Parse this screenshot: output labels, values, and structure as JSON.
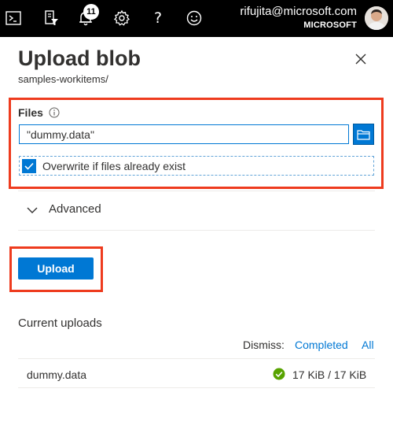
{
  "topbar": {
    "icons": [
      "cloud-shell-icon",
      "directory-filter-icon",
      "notifications-icon",
      "settings-icon",
      "help-icon",
      "feedback-icon"
    ],
    "help_glyph": "?",
    "notification_count": "11",
    "account_email": "rifujita@microsoft.com",
    "account_org": "MICROSOFT"
  },
  "panel": {
    "title": "Upload blob",
    "subtitle": "samples-workitems/",
    "close_icon": "close-icon"
  },
  "files": {
    "label": "Files",
    "value": "\"dummy.data\"",
    "overwrite_label": "Overwrite if files already exist",
    "overwrite_checked": true
  },
  "advanced": {
    "label": "Advanced",
    "expanded": false
  },
  "actions": {
    "upload_label": "Upload"
  },
  "current_uploads": {
    "title": "Current uploads",
    "dismiss_label": "Dismiss:",
    "dismiss_completed": "Completed",
    "dismiss_all": "All",
    "items": [
      {
        "name": "dummy.data",
        "size": "17 KiB / 17 KiB",
        "status": "completed"
      }
    ]
  },
  "colors": {
    "accent": "#0078d4",
    "highlight_border": "#ee3b1e",
    "success": "#57a300",
    "topbar": "#000000"
  }
}
